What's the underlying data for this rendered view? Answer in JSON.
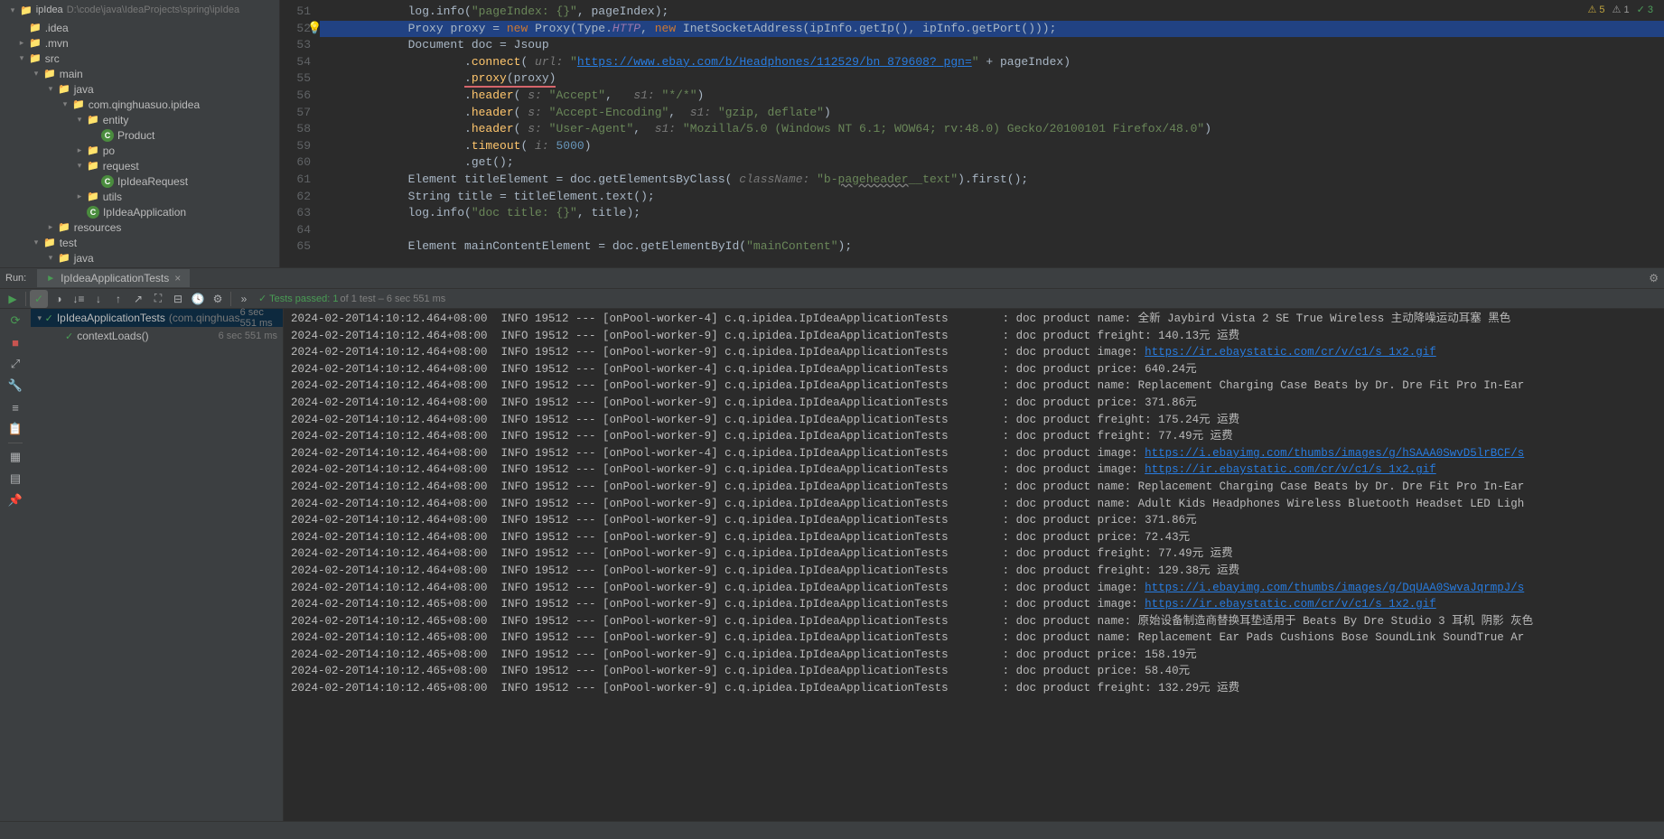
{
  "project": {
    "root": "ipIdea",
    "root_path": "D:\\code\\java\\IdeaProjects\\spring\\ipIdea",
    "nodes": [
      {
        "indent": 0,
        "chev": "",
        "icon": "folder",
        "label": ".idea"
      },
      {
        "indent": 0,
        "chev": "▸",
        "icon": "folder",
        "label": ".mvn"
      },
      {
        "indent": 0,
        "chev": "▾",
        "icon": "folder",
        "label": "src"
      },
      {
        "indent": 1,
        "chev": "▾",
        "icon": "folder",
        "label": "main"
      },
      {
        "indent": 2,
        "chev": "▾",
        "icon": "folder-blue",
        "label": "java"
      },
      {
        "indent": 3,
        "chev": "▾",
        "icon": "folder",
        "label": "com.qinghuasuo.ipidea"
      },
      {
        "indent": 4,
        "chev": "▾",
        "icon": "folder",
        "label": "entity"
      },
      {
        "indent": 5,
        "chev": "",
        "icon": "class",
        "label": "Product"
      },
      {
        "indent": 4,
        "chev": "▸",
        "icon": "folder",
        "label": "po"
      },
      {
        "indent": 4,
        "chev": "▾",
        "icon": "folder",
        "label": "request"
      },
      {
        "indent": 5,
        "chev": "",
        "icon": "class",
        "label": "IpIdeaRequest"
      },
      {
        "indent": 4,
        "chev": "▸",
        "icon": "folder",
        "label": "utils"
      },
      {
        "indent": 4,
        "chev": "",
        "icon": "class",
        "label": "IpIdeaApplication"
      },
      {
        "indent": 2,
        "chev": "▸",
        "icon": "folder",
        "label": "resources"
      },
      {
        "indent": 1,
        "chev": "▾",
        "icon": "folder",
        "label": "test"
      },
      {
        "indent": 2,
        "chev": "▾",
        "icon": "folder-blue",
        "label": "java"
      }
    ]
  },
  "editor": {
    "warnings": {
      "yellow": "5",
      "gray": "1",
      "green": "3"
    },
    "lines": [
      {
        "n": 51,
        "html": "            <span class='type'>log</span>.info(<span class='str'>\"pageIndex: {}\"</span>, pageIndex);"
      },
      {
        "n": 52,
        "hl": true,
        "bulb": true,
        "html": "            <span class='type'>Proxy</span> proxy = <span class='kw'>new</span> Proxy(Type.<span class='static-field'>HTTP</span>, <span class='kw'>new</span> InetSocketAddress(ipInfo.getIp(), ipInfo.getPort()));"
      },
      {
        "n": 53,
        "html": "            <span class='type'>Document</span> doc = Jsoup"
      },
      {
        "n": 54,
        "html": "                    .<span class='fn'>connect</span>( <span class='param-hint'>url:</span> <span class='str'>\"</span><span class='link'>https://www.ebay.com/b/Headphones/112529/bn_879608?_pgn=</span><span class='str'>\"</span> + pageIndex)"
      },
      {
        "n": 55,
        "html": "                    <span class='underline-red'>.<span class='fn'>proxy</span>(proxy)</span>"
      },
      {
        "n": 56,
        "html": "                    .<span class='fn'>header</span>( <span class='param-hint'>s:</span> <span class='str'>\"Accept\"</span>,   <span class='param-hint'>s1:</span> <span class='str'>\"*/*\"</span>)"
      },
      {
        "n": 57,
        "html": "                    .<span class='fn'>header</span>( <span class='param-hint'>s:</span> <span class='str'>\"Accept-Encoding\"</span>,  <span class='param-hint'>s1:</span> <span class='str'>\"gzip, deflate\"</span>)"
      },
      {
        "n": 58,
        "html": "                    .<span class='fn'>header</span>( <span class='param-hint'>s:</span> <span class='str'>\"User-Agent\"</span>,  <span class='param-hint'>s1:</span> <span class='str'>\"Mozilla/5.0 (Windows NT 6.1; WOW64; rv:48.0) Gecko/20100101 Firefox/48.0\"</span>)"
      },
      {
        "n": 59,
        "html": "                    .<span class='fn'>timeout</span>( <span class='param-hint'>i:</span> <span class='num'>5000</span>)"
      },
      {
        "n": 60,
        "html": "                    .get();"
      },
      {
        "n": 61,
        "html": "            <span class='type'>Element</span> titleElement = doc.getElementsByClass( <span class='param-hint'>className:</span> <span class='str'>\"b-<span class='wavy'>pageheader</span>__text\"</span>).first();"
      },
      {
        "n": 62,
        "html": "            <span class='type'>String</span> title = titleElement.text();"
      },
      {
        "n": 63,
        "html": "            <span class='type'>log</span>.info(<span class='str'>\"doc title: {}\"</span>, title);"
      },
      {
        "n": 64,
        "html": ""
      },
      {
        "n": 65,
        "html": "            <span class='type'>Element</span> mainContentElement = doc.getElementById(<span class='str'>\"mainContent\"</span>);"
      }
    ]
  },
  "run": {
    "label": "Run:",
    "tab": "IpIdeaApplicationTests",
    "tests_passed_prefix": "✓ Tests passed: 1",
    "tests_passed_suffix": " of 1 test – 6 sec 551 ms"
  },
  "test_tree": [
    {
      "indent": 0,
      "chev": "▾",
      "ok": true,
      "name": "IpIdeaApplicationTests",
      "suffix": "(com.qinghuas",
      "time": "6 sec 551 ms",
      "sel": true
    },
    {
      "indent": 1,
      "chev": "",
      "ok": true,
      "name": "contextLoads()",
      "suffix": "",
      "time": "6 sec 551 ms"
    }
  ],
  "console": [
    {
      "ts": "2024-02-20T14:10:12.464+08:00",
      "w": "4",
      "msg": ": doc product name: 全新 Jaybird Vista 2 SE True Wireless 主动降噪运动耳塞 黑色"
    },
    {
      "ts": "2024-02-20T14:10:12.464+08:00",
      "w": "9",
      "msg": ": doc product freight: 140.13元 运费"
    },
    {
      "ts": "2024-02-20T14:10:12.464+08:00",
      "w": "9",
      "msg": ": doc product image: ",
      "link": "https://ir.ebaystatic.com/cr/v/c1/s_1x2.gif"
    },
    {
      "ts": "2024-02-20T14:10:12.464+08:00",
      "w": "4",
      "msg": ": doc product price: 640.24元"
    },
    {
      "ts": "2024-02-20T14:10:12.464+08:00",
      "w": "9",
      "msg": ": doc product name: Replacement Charging Case Beats by Dr. Dre Fit Pro In-Ear"
    },
    {
      "ts": "2024-02-20T14:10:12.464+08:00",
      "w": "9",
      "msg": ": doc product price: 371.86元"
    },
    {
      "ts": "2024-02-20T14:10:12.464+08:00",
      "w": "9",
      "msg": ": doc product freight: 175.24元 运费"
    },
    {
      "ts": "2024-02-20T14:10:12.464+08:00",
      "w": "9",
      "msg": ": doc product freight: 77.49元 运费"
    },
    {
      "ts": "2024-02-20T14:10:12.464+08:00",
      "w": "4",
      "msg": ": doc product image: ",
      "link": "https://i.ebayimg.com/thumbs/images/g/hSAAA0SwvD5lrBCF/s"
    },
    {
      "ts": "2024-02-20T14:10:12.464+08:00",
      "w": "9",
      "msg": ": doc product image: ",
      "link": "https://ir.ebaystatic.com/cr/v/c1/s_1x2.gif"
    },
    {
      "ts": "2024-02-20T14:10:12.464+08:00",
      "w": "9",
      "msg": ": doc product name: Replacement Charging Case Beats by Dr. Dre Fit Pro In-Ear"
    },
    {
      "ts": "2024-02-20T14:10:12.464+08:00",
      "w": "9",
      "msg": ": doc product name: Adult Kids Headphones Wireless Bluetooth Headset LED Ligh"
    },
    {
      "ts": "2024-02-20T14:10:12.464+08:00",
      "w": "9",
      "msg": ": doc product price: 371.86元"
    },
    {
      "ts": "2024-02-20T14:10:12.464+08:00",
      "w": "9",
      "msg": ": doc product price: 72.43元"
    },
    {
      "ts": "2024-02-20T14:10:12.464+08:00",
      "w": "9",
      "msg": ": doc product freight: 77.49元 运费"
    },
    {
      "ts": "2024-02-20T14:10:12.464+08:00",
      "w": "9",
      "msg": ": doc product freight: 129.38元 运费"
    },
    {
      "ts": "2024-02-20T14:10:12.464+08:00",
      "w": "9",
      "msg": ": doc product image: ",
      "link": "https://i.ebayimg.com/thumbs/images/g/DqUAA0SwvaJqrmpJ/s"
    },
    {
      "ts": "2024-02-20T14:10:12.465+08:00",
      "w": "9",
      "msg": ": doc product image: ",
      "link": "https://ir.ebaystatic.com/cr/v/c1/s_1x2.gif"
    },
    {
      "ts": "2024-02-20T14:10:12.465+08:00",
      "w": "9",
      "msg": ": doc product name: 原始设备制造商替换耳垫适用于 Beats By Dre Studio 3 耳机 阴影 灰色"
    },
    {
      "ts": "2024-02-20T14:10:12.465+08:00",
      "w": "9",
      "msg": ": doc product name: Replacement Ear Pads Cushions Bose SoundLink SoundTrue Ar"
    },
    {
      "ts": "2024-02-20T14:10:12.465+08:00",
      "w": "9",
      "msg": ": doc product price: 158.19元"
    },
    {
      "ts": "2024-02-20T14:10:12.465+08:00",
      "w": "9",
      "msg": ": doc product price: 58.40元"
    },
    {
      "ts": "2024-02-20T14:10:12.465+08:00",
      "w": "9",
      "msg": ": doc product freight: 132.29元 运费"
    }
  ]
}
